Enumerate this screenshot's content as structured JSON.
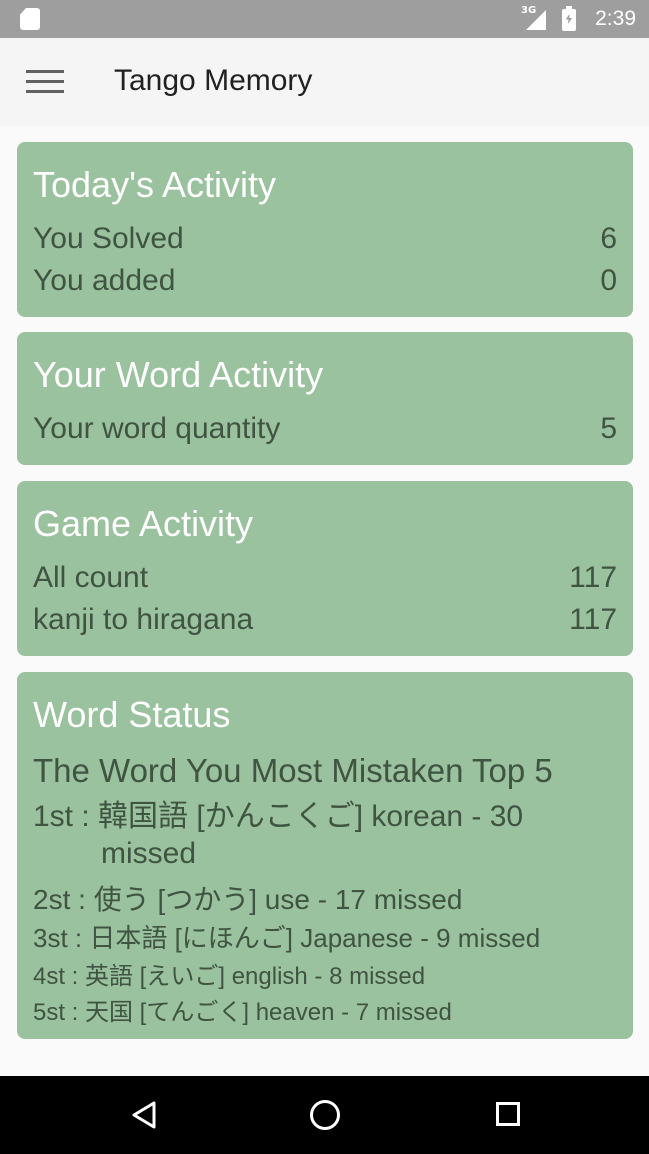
{
  "status_bar": {
    "network": "3G",
    "time": "2:39",
    "icons": [
      "sd-card-icon",
      "signal-icon",
      "battery-charging-icon"
    ]
  },
  "app_bar": {
    "title": "Tango Memory",
    "menu_icon": "menu-icon"
  },
  "colors": {
    "card_bg": "#9bc29e",
    "card_title": "#ffffff",
    "card_text": "#3f5441",
    "status_bar": "#9e9e9e",
    "app_bar": "#f5f5f5"
  },
  "todays_activity": {
    "title": "Today's Activity",
    "rows": [
      {
        "label": "You Solved",
        "value": "6"
      },
      {
        "label": "You added",
        "value": "0"
      }
    ]
  },
  "word_activity": {
    "title": "Your Word Activity",
    "rows": [
      {
        "label": "Your word quantity",
        "value": "5"
      }
    ]
  },
  "game_activity": {
    "title": "Game Activity",
    "rows": [
      {
        "label": "All count",
        "value": "117"
      },
      {
        "label": "kanji to hiragana",
        "value": "117"
      }
    ]
  },
  "word_status": {
    "title": "Word Status",
    "subtitle": "The Word You Most Mistaken Top 5",
    "ranks": [
      {
        "line1": "1st : 韓国語 [かんこくご] korean - 30",
        "line2": "missed"
      },
      {
        "text": "2st : 使う [つかう] use - 17 missed"
      },
      {
        "text": "3st : 日本語 [にほんご] Japanese - 9 missed"
      },
      {
        "text": "4st : 英語 [えいご] english - 8 missed"
      },
      {
        "text": "5st : 天国 [てんごく] heaven - 7 missed"
      }
    ]
  },
  "nav_bar": {
    "icons": [
      "back-icon",
      "home-icon",
      "recents-icon"
    ]
  }
}
